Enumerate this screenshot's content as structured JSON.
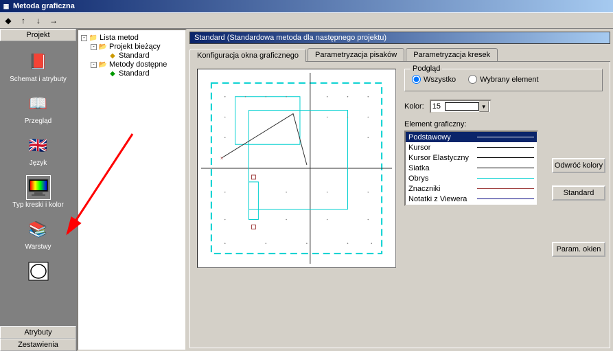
{
  "window": {
    "title": "Metoda graficzna"
  },
  "leftpanel": {
    "header": "Projekt",
    "items": [
      {
        "label": "Schemat i atrybuty"
      },
      {
        "label": "Przegląd"
      },
      {
        "label": "Język"
      },
      {
        "label": "Typ kreski i kolor"
      },
      {
        "label": "Warstwy"
      },
      {
        "label": ""
      }
    ],
    "footer1": "Atrybuty",
    "footer2": "Zestawienia"
  },
  "tree": {
    "root": "Lista metod",
    "n1": "Projekt bieżący",
    "n1a": "Standard",
    "n2": "Metody dostępne",
    "n2a": "Standard"
  },
  "right": {
    "title": "Standard (Standardowa metoda dla następnego projektu)",
    "tabs": [
      "Konfiguracja okna graficznego",
      "Parametryzacja pisaków",
      "Parametryzacja kresek"
    ],
    "preview_group": "Podgląd",
    "radio_all": "Wszystko",
    "radio_sel": "Wybrany element",
    "color_label": "Kolor:",
    "color_value": "15",
    "elem_label": "Element graficzny:",
    "elements": [
      {
        "name": "Podstawowy",
        "color": "#ffffff",
        "sel": true
      },
      {
        "name": "Kursor",
        "color": "#000000"
      },
      {
        "name": "Kursor Elastyczny",
        "color": "#000000"
      },
      {
        "name": "Siatka",
        "color": "#000000"
      },
      {
        "name": "Obrys",
        "color": "#00e0e0"
      },
      {
        "name": "Znaczniki",
        "color": "#c04040"
      },
      {
        "name": "Notatki z Viewera",
        "color": "#000080"
      }
    ],
    "btn_invert": "Odwróć kolory",
    "btn_standard": "Standard",
    "btn_param": "Param. okien"
  }
}
